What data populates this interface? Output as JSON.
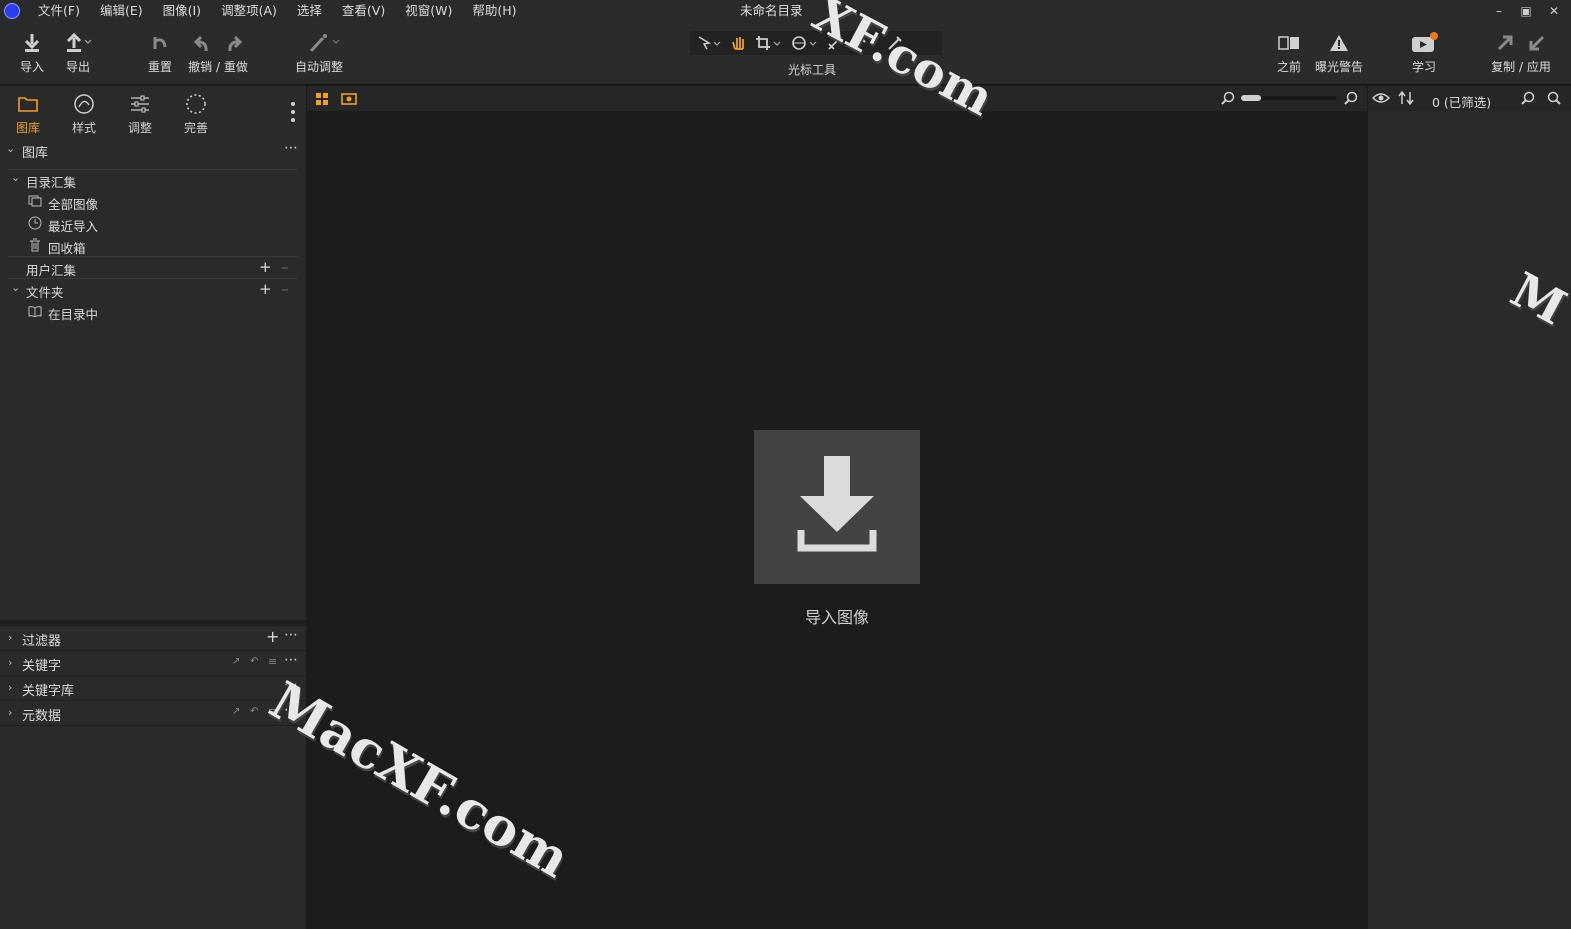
{
  "window": {
    "title": "未命名目录"
  },
  "menu": [
    "文件(F)",
    "编辑(E)",
    "图像(I)",
    "调整项(A)",
    "选择",
    "查看(V)",
    "视窗(W)",
    "帮助(H)"
  ],
  "toolbar": {
    "import": "导入",
    "export": "导出",
    "reset": "重置",
    "undo_redo": "撤销 / 重做",
    "auto_adjust": "自动调整",
    "cursor_tools": "光标工具",
    "before": "之前",
    "exposure_warning": "曝光警告",
    "learn": "学习",
    "copy_apply": "复制 / 应用"
  },
  "left_tabs": [
    {
      "label": "图库",
      "icon": "folder-icon",
      "active": true
    },
    {
      "label": "样式",
      "icon": "styles-icon",
      "active": false
    },
    {
      "label": "调整",
      "icon": "sliders-icon",
      "active": false
    },
    {
      "label": "完善",
      "icon": "refine-icon",
      "active": false
    }
  ],
  "library": {
    "header": "图库",
    "catalog_collections": "目录汇集",
    "items": [
      {
        "label": "全部图像",
        "icon": "all-images-icon"
      },
      {
        "label": "最近导入",
        "icon": "clock-icon"
      },
      {
        "label": "回收箱",
        "icon": "trash-icon"
      }
    ],
    "user_collections": "用户汇集",
    "folders": "文件夹",
    "in_catalog": "在目录中"
  },
  "bottom_panels": [
    "过滤器",
    "关键字",
    "关键字库",
    "元数据"
  ],
  "center": {
    "import_label": "导入图像"
  },
  "right": {
    "filter_count": "0 (已筛选)"
  },
  "watermark": {
    "text": "MacXF.com",
    "partial_top": "XF.com",
    "partial_right": "M"
  },
  "colors": {
    "accent": "#f0a020",
    "app_icon": "#2d3df0"
  }
}
